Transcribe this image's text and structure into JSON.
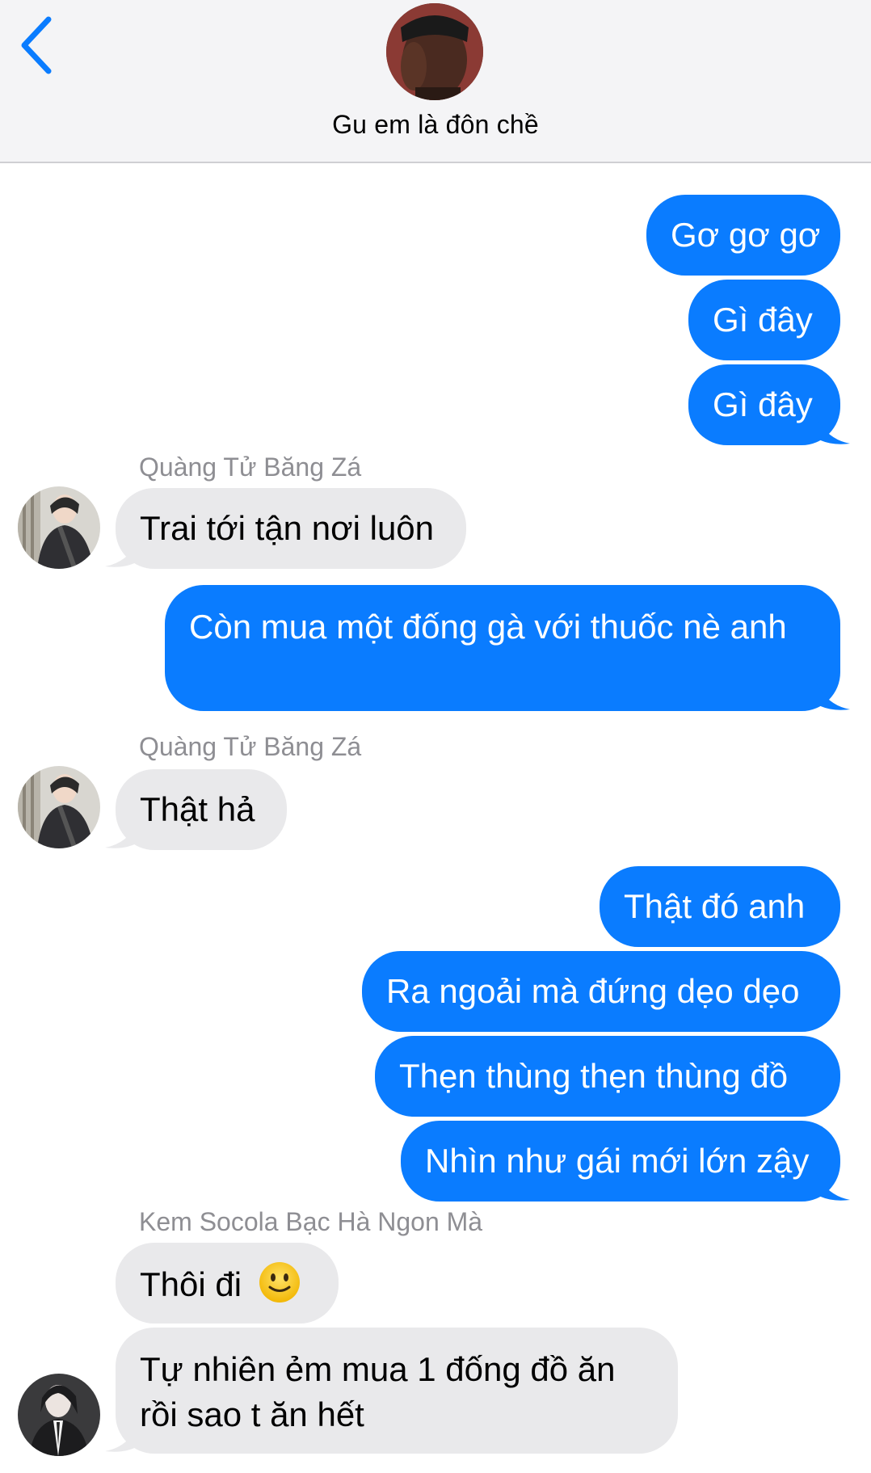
{
  "header": {
    "group_name": "Gu em là đôn chề",
    "back_icon": "chevron-left-icon",
    "accent_color": "#0a7cff"
  },
  "messages": [
    {
      "side": "out",
      "text": "Gơ gơ gơ"
    },
    {
      "side": "out",
      "text": "Gì đây"
    },
    {
      "side": "out",
      "text": "Gì đây"
    },
    {
      "side": "in",
      "sender": "Quàng Tử Băng Zá",
      "text": "Trai tới tận nơi luôn"
    },
    {
      "side": "out",
      "text": "Còn mua một đống gà với thuốc nè anh"
    },
    {
      "side": "in",
      "sender": "Quàng Tử Băng Zá",
      "text": "Thật hả"
    },
    {
      "side": "out",
      "text": "Thật đó anh"
    },
    {
      "side": "out",
      "text": "Ra ngoải mà đứng dẹo dẹo"
    },
    {
      "side": "out",
      "text": "Thẹn thùng thẹn thùng đồ"
    },
    {
      "side": "out",
      "text": "Nhìn như gái mới lớn zậy"
    },
    {
      "side": "in",
      "sender": "Kem Socola Bạc Hà Ngon Mà",
      "text": "Thôi đi",
      "emoji": "slightly-smiling-face-icon"
    },
    {
      "side": "in",
      "text": "Tự nhiên ẻm mua 1 đống đồ ăn rồi sao t ăn hết"
    }
  ]
}
